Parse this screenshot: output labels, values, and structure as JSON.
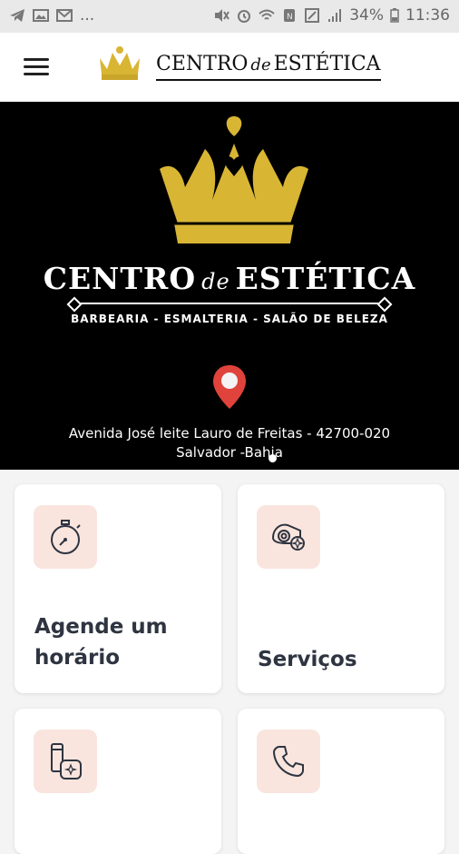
{
  "status_bar": {
    "left_icons": [
      "telegram-icon",
      "image-icon",
      "gmail-icon"
    ],
    "overflow": "...",
    "right_icons": [
      "mute-icon",
      "alarm-icon",
      "wifi-icon",
      "nfc-icon",
      "data-icon",
      "signal-icon"
    ],
    "battery": "34%",
    "time": "11:36"
  },
  "top_bar": {
    "brand": {
      "word1": "CENTRO",
      "word2": "de",
      "word3": "ESTÉTICA"
    }
  },
  "hero": {
    "title": {
      "word1": "CENTRO",
      "word2": "de",
      "word3": "ESTÉTICA"
    },
    "subtitle": "BARBEARIA - ESMALTERIA - SALÃO DE BELEZA",
    "address_line1": "Avenida José leite Lauro de Freitas - 42700-020",
    "address_line2": "Salvador -Bahia"
  },
  "cards": [
    {
      "label_line1": "Agende um",
      "label_line2": "horário",
      "icon": "stopwatch-icon"
    },
    {
      "label_line1": "Serviços",
      "icon": "towel-flower-icon"
    },
    {
      "label_line1": "",
      "icon": "cosmetics-icon"
    },
    {
      "label_line1": "",
      "icon": "phone-icon"
    }
  ],
  "colors": {
    "gold": "#d9b534",
    "icon_bg": "#f9e5de",
    "pin_red": "#e0433b",
    "label": "#2e3440"
  }
}
